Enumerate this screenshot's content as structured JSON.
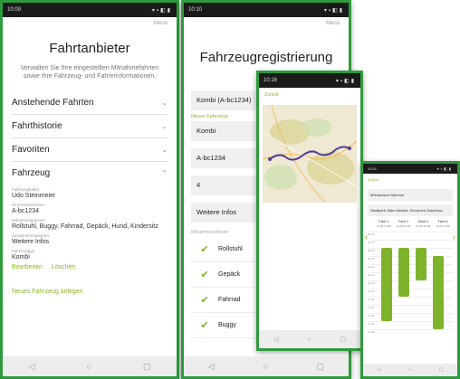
{
  "phone1": {
    "status_time": "10:09",
    "menu": "Menü",
    "title": "Fahrtanbieter",
    "description": "Verwalten Sie Ihre eingestellten Mitnahmefahrten sowie Ihre Fahrzeug- und Fahrerinformationen.",
    "sections": [
      "Anstehende Fahrten",
      "Fahrthistorie",
      "Favoriten",
      "Fahrzeug"
    ],
    "fields": [
      {
        "label": "Fahrzeughalter",
        "value": "Udo Steinmeier"
      },
      {
        "label": "KFZ-Kennzeichen",
        "value": "A-bc1234"
      },
      {
        "label": "Mitnahmeoptionen",
        "value": "Rollstuhl, Buggy, Fahrrad, Gepäck, Hund, Kindersitz"
      },
      {
        "label": "Zusatzinformationen",
        "value": "Weitere Infos"
      },
      {
        "label": "Fahrzeugtyp",
        "value": "Kombi"
      }
    ],
    "edit": "Bearbeiten",
    "delete": "Löschen",
    "new_vehicle": "Neues Fahrzeug anlegen"
  },
  "phone2": {
    "status_time": "10:10",
    "menu": "Menü",
    "title": "Fahrzeugregistrierung",
    "selected_vehicle": "Kombi (A-bc1234)",
    "new_vehicle_label": "Neues Fahrzeug",
    "vehicle_type": "Kombi",
    "plate": "A-bc1234",
    "seats": "4",
    "more_info": "Weitere Infos",
    "options_label": "Mitnahmeoptionen",
    "options": [
      "Rollstuhl",
      "Gepäck",
      "Fahrrad",
      "Buggy"
    ]
  },
  "phone3": {
    "status_time": "10:16",
    "back": "Zurück"
  },
  "phone4": {
    "status_time": "10:21",
    "back": "Zurück",
    "from": "Mühlackeck Bahnhof",
    "to": "Waldpark Olten Meister, Ebrunnen Zahnhaus",
    "trips": [
      {
        "label": "Fahrt 1",
        "info": "11.05\n10.55"
      },
      {
        "label": "Fahrt 2",
        "info": "11.06\n10.56"
      },
      {
        "label": "Fahrt 3",
        "info": "11.06\n10.58"
      },
      {
        "label": "Fahrt 4",
        "info": "11.04\n10.55"
      }
    ],
    "times": [
      "09:00",
      "09:15",
      "09:30",
      "09:45",
      "10:00",
      "10:15",
      "10:30",
      "10:45",
      "11:00",
      "11:15",
      "11:30",
      "11:45",
      "12:00"
    ]
  },
  "colors": {
    "frame": "#2f9a3d",
    "accent": "#8bb528",
    "route": "#4d3f95"
  }
}
